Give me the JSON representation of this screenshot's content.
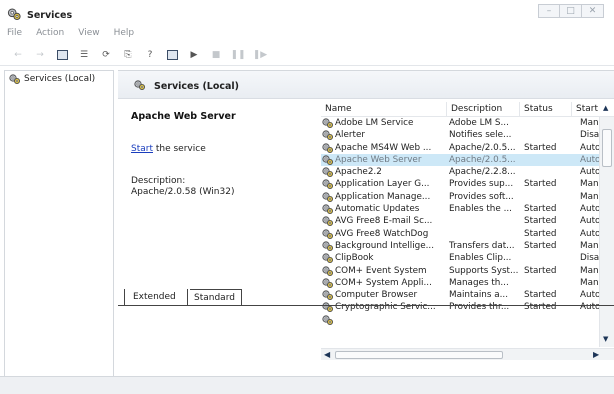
{
  "window": {
    "title": "Services"
  },
  "menu": [
    "File",
    "Action",
    "View",
    "Help"
  ],
  "tree": {
    "root_label": "Services (Local)"
  },
  "pane": {
    "title": "Services (Local)"
  },
  "detail": {
    "service_name": "Apache Web Server",
    "action_link": "Start",
    "action_suffix": " the service",
    "description_label": "Description:",
    "description_text": "Apache/2.0.58 (Win32)"
  },
  "columns": {
    "name": "Name",
    "description": "Description",
    "status": "Status",
    "startup": "Start"
  },
  "services": [
    {
      "name": "Adobe LM Service",
      "description": "Adobe LM S...",
      "status": "",
      "startup": "Man"
    },
    {
      "name": "Alerter",
      "description": "Notifies sele...",
      "status": "",
      "startup": "Disal"
    },
    {
      "name": "Apache MS4W Web ...",
      "description": "Apache/2.0.5...",
      "status": "Started",
      "startup": "Auto"
    },
    {
      "name": "Apache Web Server",
      "description": "Apache/2.0.5...",
      "status": "",
      "startup": "Auto",
      "selected": true
    },
    {
      "name": "Apache2.2",
      "description": "Apache/2.2.8...",
      "status": "",
      "startup": "Auto"
    },
    {
      "name": "Application Layer G...",
      "description": "Provides sup...",
      "status": "Started",
      "startup": "Man"
    },
    {
      "name": "Application Manage...",
      "description": "Provides soft...",
      "status": "",
      "startup": "Man"
    },
    {
      "name": "Automatic Updates",
      "description": "Enables the ...",
      "status": "Started",
      "startup": "Auto"
    },
    {
      "name": "AVG Free8 E-mail Sc...",
      "description": "",
      "status": "Started",
      "startup": "Auto"
    },
    {
      "name": "AVG Free8 WatchDog",
      "description": "",
      "status": "Started",
      "startup": "Auto"
    },
    {
      "name": "Background Intellige...",
      "description": "Transfers dat...",
      "status": "Started",
      "startup": "Man"
    },
    {
      "name": "ClipBook",
      "description": "Enables Clip...",
      "status": "",
      "startup": "Disal"
    },
    {
      "name": "COM+ Event System",
      "description": "Supports Syst...",
      "status": "Started",
      "startup": "Man"
    },
    {
      "name": "COM+ System Appli...",
      "description": "Manages th...",
      "status": "",
      "startup": "Man"
    },
    {
      "name": "Computer Browser",
      "description": "Maintains a...",
      "status": "Started",
      "startup": "Auto"
    },
    {
      "name": "Cryptographic Servic...",
      "description": "Provides thr...",
      "status": "Started",
      "startup": "Auto"
    },
    {
      "name": "",
      "description": "",
      "status": "",
      "startup": ""
    }
  ],
  "tabs": {
    "extended": "Extended",
    "standard": "Standard"
  }
}
